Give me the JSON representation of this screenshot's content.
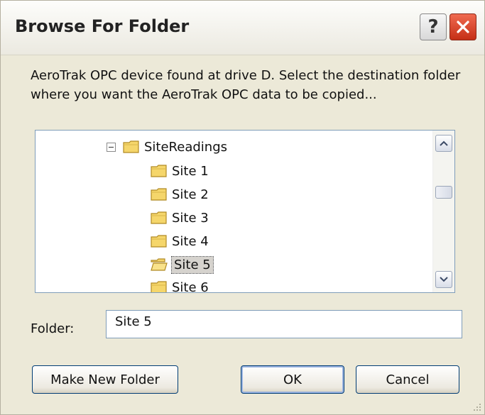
{
  "window": {
    "title": "Browse For Folder",
    "help_glyph": "?"
  },
  "message": "AeroTrak OPC device found at drive D.  Select the destination folder where you want the AeroTrak OPC data to be copied...",
  "tree": {
    "parent": "SiteReadings",
    "items": [
      "Site 1",
      "Site 2",
      "Site 3",
      "Site 4",
      "Site 5",
      "Site 6"
    ],
    "selected": "Site 5"
  },
  "folder": {
    "label": "Folder:",
    "value": "Site 5"
  },
  "buttons": {
    "make_new_folder": "Make New Folder",
    "ok": "OK",
    "cancel": "Cancel"
  },
  "colors": {
    "folder_fill": "#f5d66b",
    "folder_stroke": "#b08a24",
    "selection_bg": "#d6d3ce"
  },
  "icons": [
    "help-icon",
    "close-icon",
    "folder-icon",
    "collapse-icon",
    "arrow-up-icon",
    "arrow-down-icon",
    "resize-grip-icon"
  ]
}
